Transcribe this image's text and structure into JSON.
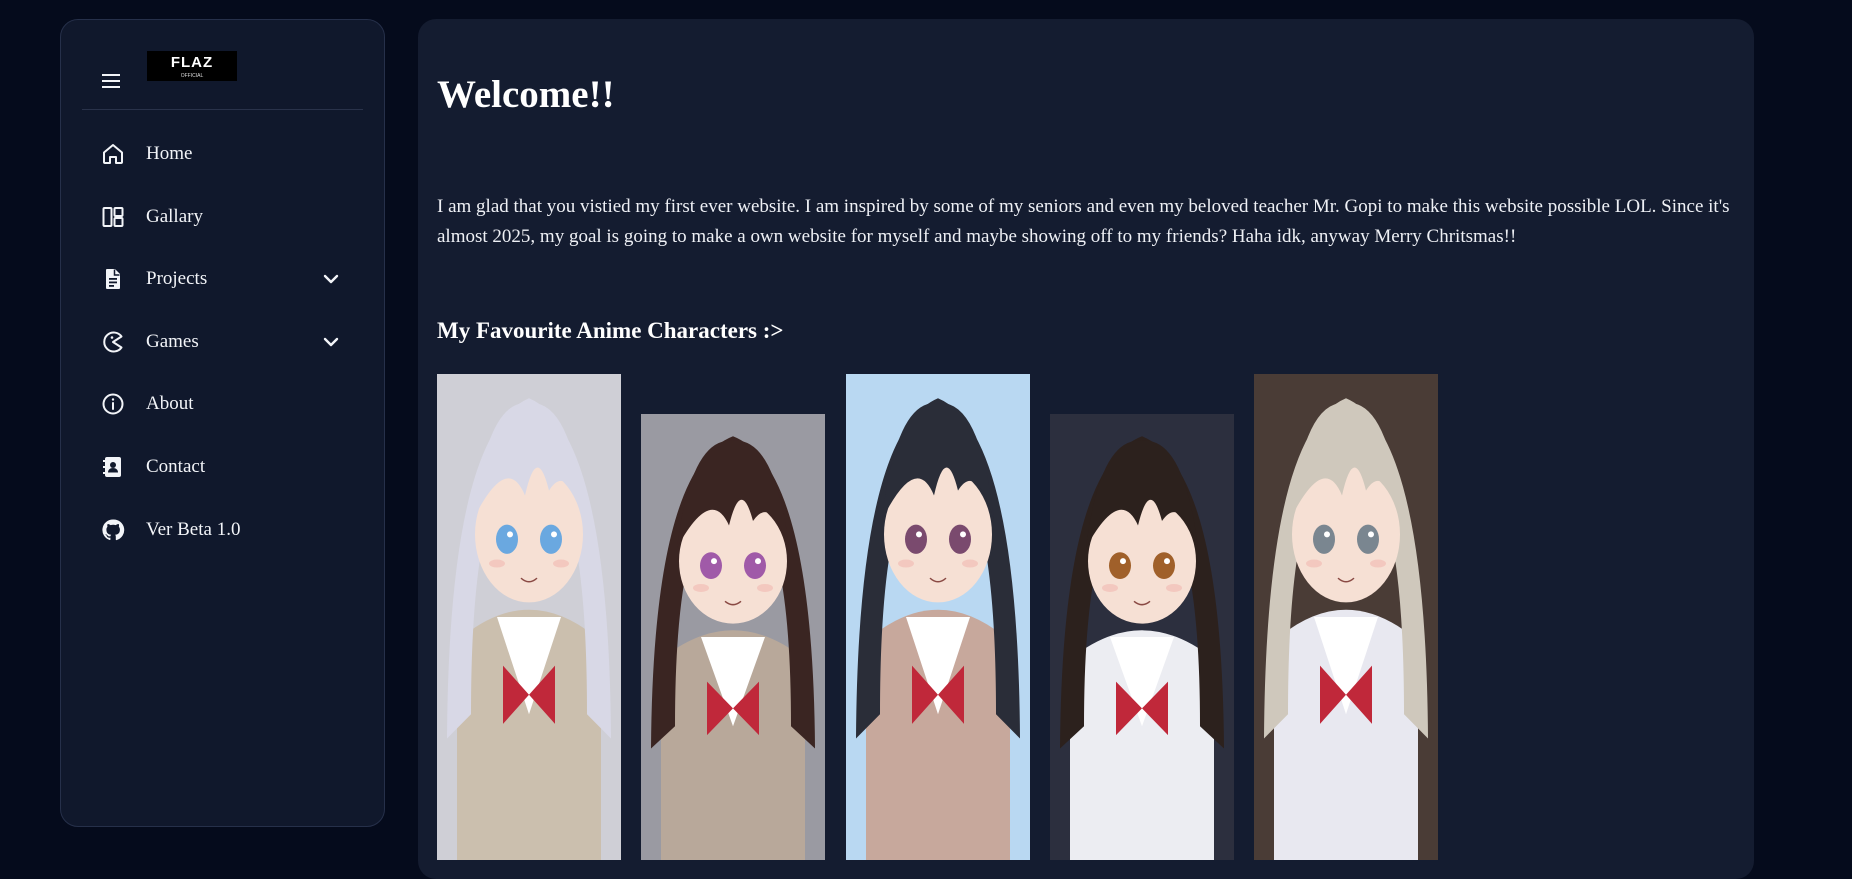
{
  "sidebar": {
    "logo": {
      "main": "FLAZ",
      "sub": "OFFICIAL"
    },
    "items": [
      {
        "label": "Home",
        "icon": "home-icon"
      },
      {
        "label": "Gallary",
        "icon": "gallery-icon"
      },
      {
        "label": "Projects",
        "icon": "document-icon",
        "dropdown": true
      },
      {
        "label": "Games",
        "icon": "pacman-icon",
        "dropdown": true
      },
      {
        "label": "About",
        "icon": "info-icon"
      },
      {
        "label": "Contact",
        "icon": "contact-card-icon"
      },
      {
        "label": "Ver Beta 1.0",
        "icon": "github-icon"
      }
    ]
  },
  "main": {
    "title": "Welcome!!",
    "intro": "I am glad that you vistied my first ever website. I am inspired by some of my seniors and even my beloved teacher Mr. Gopi to make this website possible LOL. Since it's almost 2025, my goal is going to make a own website for myself and maybe showing off to my friends? Haha idk, anyway Merry Chritsmas!!",
    "subtitle": "My Favourite Anime Characters :>",
    "characters": [
      {
        "hair": "#d8d8e6",
        "eyes": "#6aa8e0",
        "bg": "#cfcfd6",
        "outfit": "#cbbfae"
      },
      {
        "hair": "#3a2522",
        "eyes": "#a05aa8",
        "bg": "#9a9aa2",
        "outfit": "#b8a89a"
      },
      {
        "hair": "#2a2d38",
        "eyes": "#7a4a6e",
        "bg": "#b9d8f2",
        "outfit": "#c7a89c"
      },
      {
        "hair": "#2c211d",
        "eyes": "#a0602a",
        "bg": "#2c2f3e",
        "outfit": "#ecedf2"
      },
      {
        "hair": "#cfc8bc",
        "eyes": "#7a8690",
        "bg": "#4a3c36",
        "outfit": "#e8e8f0"
      }
    ]
  },
  "colors": {
    "page_bg": "#050b1c",
    "panel_bg": "#141c30",
    "sidebar_bg": "#10182c",
    "text": "#f2f4f8"
  }
}
